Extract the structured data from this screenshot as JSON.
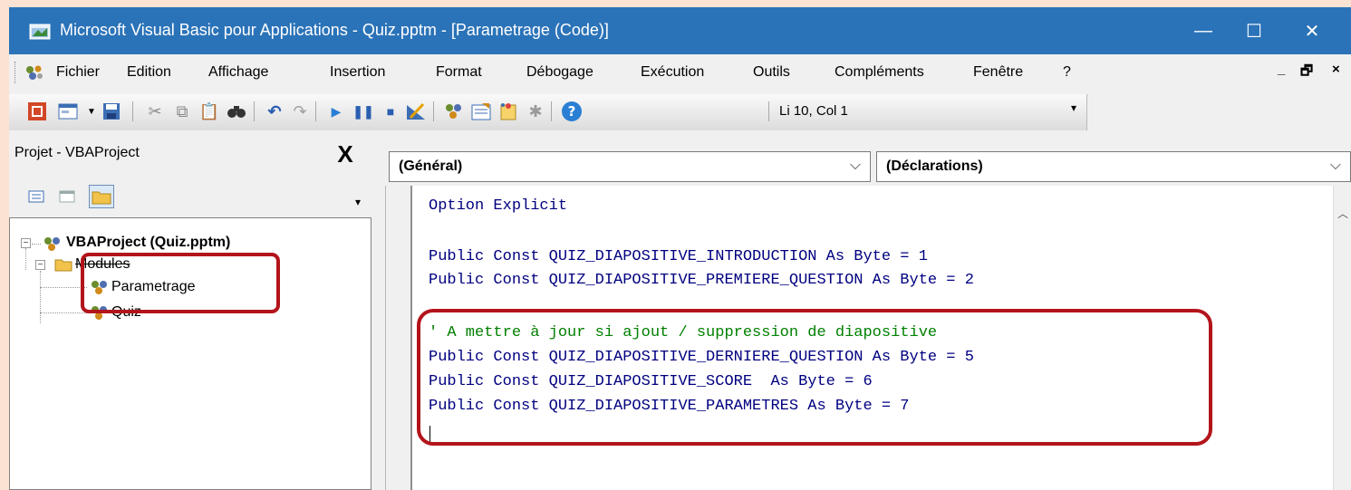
{
  "window": {
    "title": "Microsoft Visual Basic pour Applications - Quiz.pptm - [Parametrage (Code)]",
    "controls": [
      "—",
      "☐",
      "✕"
    ]
  },
  "menu": {
    "items": [
      "Fichier",
      "Edition",
      "Affichage",
      "Insertion",
      "Format",
      "Débogage",
      "Exécution",
      "Outils",
      "Compléments",
      "Fenêtre",
      "?"
    ],
    "mdi_controls": [
      "_",
      "🗗",
      "×"
    ]
  },
  "toolbar": {
    "position": "Li 10, Col 1",
    "icons": [
      "powerpoint-icon",
      "insert-userform-icon",
      "save-icon",
      "cut-icon",
      "copy-icon",
      "paste-icon",
      "find-icon",
      "undo-icon",
      "redo-icon",
      "run-icon",
      "break-icon",
      "reset-icon",
      "design-mode-icon",
      "project-explorer-icon",
      "properties-icon",
      "object-browser-icon",
      "toolbox-icon",
      "help-icon"
    ]
  },
  "project": {
    "title": "Projet - VBAProject",
    "close": "X",
    "tree": {
      "root": "VBAProject (Quiz.pptm)",
      "folder": "Modules",
      "modules": [
        "Parametrage",
        "Quiz"
      ]
    }
  },
  "code": {
    "object_combo": "(Général)",
    "proc_combo": "(Déclarations)",
    "lines": [
      "Option Explicit",
      "",
      "Public Const QUIZ_DIAPOSITIVE_INTRODUCTION As Byte = 1",
      "Public Const QUIZ_DIAPOSITIVE_PREMIERE_QUESTION As Byte = 2",
      "",
      "' A mettre à jour si ajout / suppression de diapositive",
      "Public Const QUIZ_DIAPOSITIVE_DERNIERE_QUESTION As Byte = 5",
      "Public Const QUIZ_DIAPOSITIVE_SCORE  As Byte = 6",
      "Public Const QUIZ_DIAPOSITIVE_PARAMETRES As Byte = 7"
    ]
  },
  "colors": {
    "highlight": "#b3141b",
    "code_text": "#000080",
    "comment": "#008000",
    "titlebar": "#2b73b8"
  }
}
